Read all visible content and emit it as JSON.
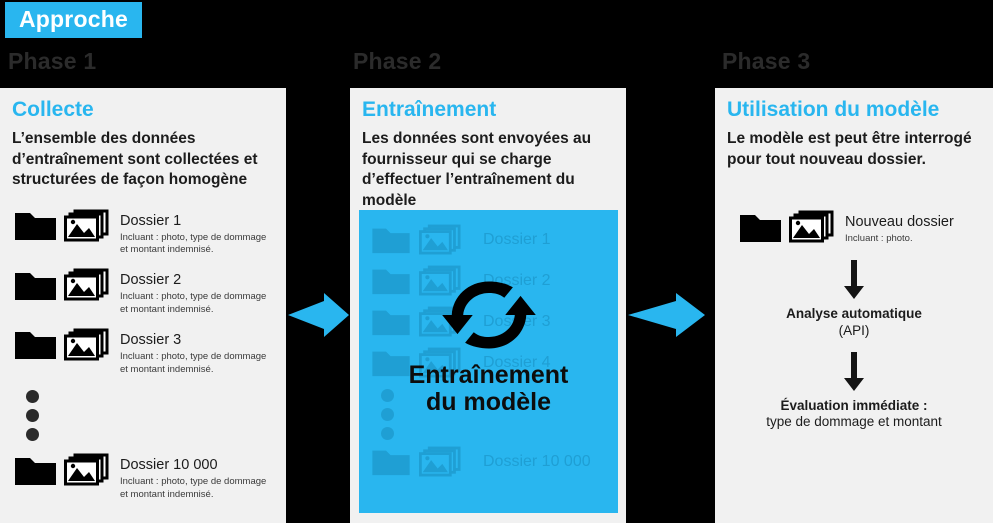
{
  "badge": {
    "label": "Approche"
  },
  "colors": {
    "accent": "#29b6ef",
    "panel_bg": "#f1f1f1",
    "page_bg": "#000000",
    "ghost": "#1f9fd4",
    "text": "#1c1c1c"
  },
  "phases": [
    {
      "label": "Phase 1"
    },
    {
      "label": "Phase 2"
    },
    {
      "label": "Phase 3"
    }
  ],
  "column1": {
    "title": "Collecte",
    "description": "L’ensemble des données d’entraînement sont collectées et structurées de façon homogène",
    "rows": [
      {
        "title": "Dossier 1",
        "sub": "Incluant : photo, type de dommage et montant indemnisé."
      },
      {
        "title": "Dossier 2",
        "sub": "Incluant : photo, type de dommage et montant indemnisé."
      },
      {
        "title": "Dossier 3",
        "sub": "Incluant : photo, type de dommage et montant indemnisé."
      }
    ],
    "last_row": {
      "title": "Dossier 10 000",
      "sub": "Incluant : photo, type de dommage et montant indemnisé."
    }
  },
  "column2": {
    "title": "Entraînement",
    "description": "Les données sont envoyées au fournisseur qui se charge d’effectuer l’entraînement du modèle",
    "ghost_rows": [
      {
        "label": "Dossier 1"
      },
      {
        "label": "Dossier 2"
      },
      {
        "label": "Dossier 3"
      },
      {
        "label": "Dossier 4"
      }
    ],
    "ghost_last": {
      "label": "Dossier 10 000"
    },
    "overlay_line1": "Entraînement",
    "overlay_line2": "du modèle"
  },
  "column3": {
    "title": "Utilisation du modèle",
    "description": "Le modèle est peut être interrogé pour tout nouveau dossier.",
    "row": {
      "title": "Nouveau dossier",
      "sub": "Incluant : photo."
    },
    "step1_bold": "Analyse automatique",
    "step1_norm": "(API)",
    "step2_bold": "Évaluation immédiate :",
    "step2_norm": "type de dommage et montant"
  }
}
